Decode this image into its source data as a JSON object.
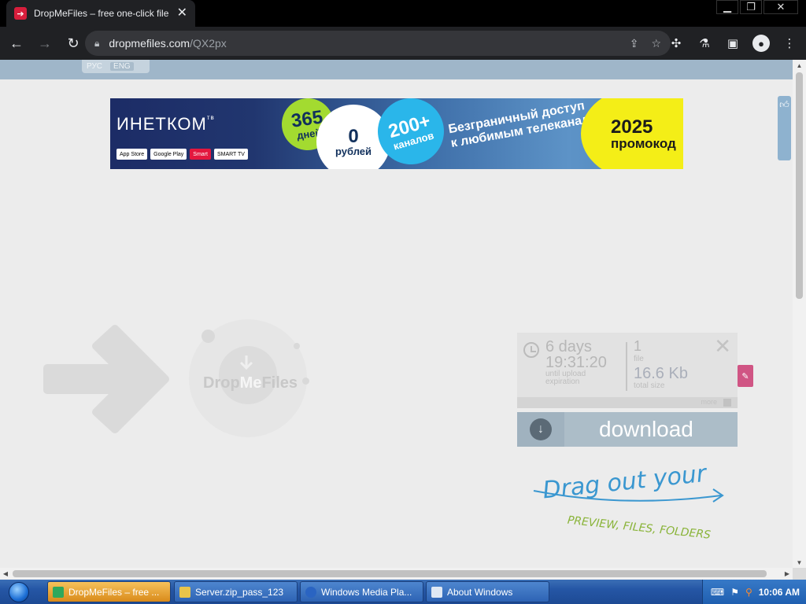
{
  "browser": {
    "tab_title": "DropMeFiles – free one-click file sha",
    "url_host": "dropmefiles.com",
    "url_path": "/QX2px"
  },
  "page": {
    "lang": [
      "РУС",
      "ENG"
    ],
    "banner": {
      "brand": "ИНЕТКОМ",
      "brand_sup": "тв",
      "stores": [
        "App Store",
        "Google Play",
        "Smart",
        "SMART TV"
      ],
      "c1_top": "365",
      "c1_bottom": "дней",
      "c2_top": "0",
      "c2_bottom": "рублей",
      "c3_top": "200+",
      "c3_bottom": "каналов",
      "headline_1": "Безграничный доступ",
      "headline_2": "к любимым телеканалам",
      "promo_year": "2025",
      "promo_word": "промокод"
    },
    "logo": {
      "prefix": "Drop",
      "me": "Me",
      "suffix": "Files"
    },
    "info": {
      "days": "6 days",
      "time": "19:31:20",
      "until": "until upload expiration",
      "count": "1",
      "count_label": "file",
      "size": "16.6 Kb",
      "size_label": "total size",
      "more": "more"
    },
    "download_label": "download",
    "drag_main": "Drag out your",
    "drag_sub": "PREVIEW, FILES, FOLDERS"
  },
  "taskbar": {
    "items": [
      "DropMeFiles – free ...",
      "Server.zip_pass_123",
      "Windows Media Pla...",
      "About Windows"
    ],
    "time": "10:06 AM"
  }
}
